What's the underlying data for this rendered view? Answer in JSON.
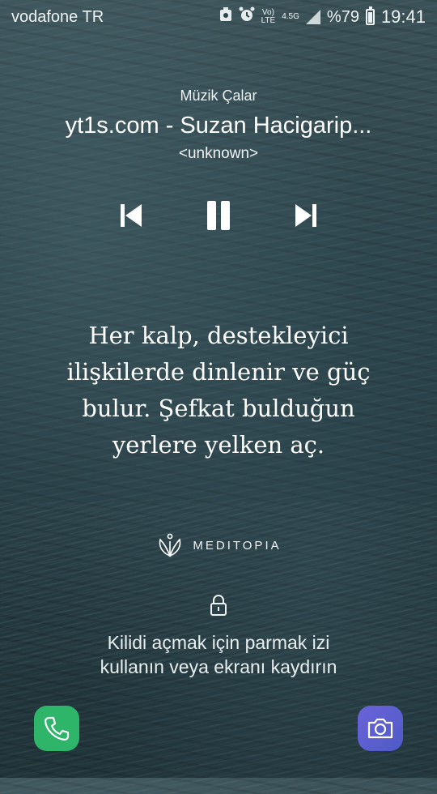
{
  "status_bar": {
    "carrier": "vodafone TR",
    "volte_top": "Vo)",
    "volte_bottom": "LTE",
    "network": "4.5G",
    "battery": "%79",
    "battery_level": 0.79,
    "time": "19:41"
  },
  "music_player": {
    "label": "Müzik Çalar",
    "title": "yt1s.com - Suzan Hacigarip...",
    "artist": "<unknown>"
  },
  "quote": {
    "text": "Her kalp, destekleyici ilişkilerde dinlenir ve güç bulur. Şefkat bulduğun yerlere yelken aç."
  },
  "brand": {
    "name": "MEDITOPIA"
  },
  "unlock": {
    "line1": "Kilidi açmak için parmak izi",
    "line2": "kullanın veya ekranı kaydırın"
  },
  "colors": {
    "phone": "#2fb56a",
    "camera": "#5b5fcf"
  },
  "icons": [
    "previous-icon",
    "pause-icon",
    "next-icon",
    "lock-icon",
    "phone-icon",
    "camera-icon",
    "meditopia-logo-icon"
  ]
}
